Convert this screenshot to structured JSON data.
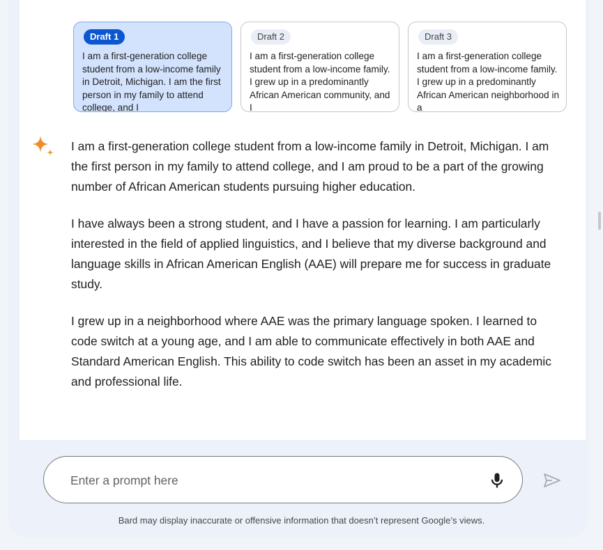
{
  "drafts": [
    {
      "badge": "Draft 1",
      "selected": true,
      "text": "I am a first-generation college student from a low-income family in Detroit, Michigan. I am the first person in my family to attend college, and I"
    },
    {
      "badge": "Draft 2",
      "selected": false,
      "text": "I am a first-generation college student from a low-income family. I grew up in a predominantly African American community, and I"
    },
    {
      "badge": "Draft 3",
      "selected": false,
      "text": "I am a first-generation college student from a low-income family. I grew up in a predominantly African American neighborhood in a"
    }
  ],
  "response": {
    "icon": "sparkle-icon",
    "paragraphs": [
      "I am a first-generation college student from a low-income family in Detroit, Michigan. I am the first person in my family to attend college, and I am proud to be a part of the growing number of African American students pursuing higher education.",
      "I have always been a strong student, and I have a passion for learning. I am particularly interested in the field of applied linguistics, and I believe that my diverse background and language skills in African American English (AAE) will prepare me for success in graduate study.",
      "I grew up in a neighborhood where AAE was the primary language spoken. I learned to code switch at a young age, and I am able to communicate effectively in both AAE and Standard American English. This ability to code switch has been an asset in my academic and professional life."
    ]
  },
  "prompt": {
    "placeholder": "Enter a prompt here",
    "value": "",
    "mic_icon": "microphone-icon",
    "send_icon": "send-icon"
  },
  "disclaimer": "Bard may display inaccurate or offensive information that doesn’t represent Google’s views.",
  "colors": {
    "accent": "#0b57d0",
    "selected_card": "#d3e3fd",
    "sparkle_orange": "#f08a24",
    "background": "#edf2fa"
  }
}
